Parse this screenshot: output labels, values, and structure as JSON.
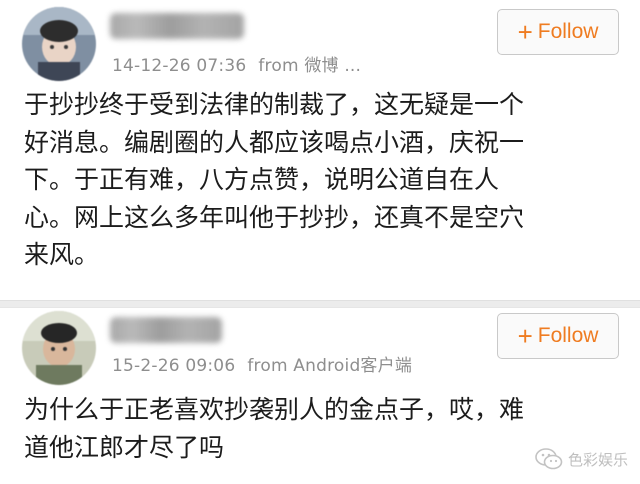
{
  "posts": [
    {
      "time": "14-12-26 07:36",
      "source": "from 微博 ...",
      "follow_label": "Follow",
      "follow_plus": "+",
      "text": "于抄抄终于受到法律的制裁了，这无疑是一个好消息。编剧圈的人都应该喝点小酒，庆祝一下。于正有难，八方点赞，说明公道自在人心。网上这么多年叫他于抄抄，还真不是空穴来风。",
      "lines": [
        "于抄抄终于受到法律的制裁了，这无疑是一个",
        "好消息。编剧圈的人都应该喝点小酒，庆祝一",
        "下。于正有难，八方点赞，说明公道自在人",
        "心。网上这么多年叫他于抄抄，还真不是空穴",
        "来风。"
      ]
    },
    {
      "time": "15-2-26 09:06",
      "source": "from Android客户端",
      "follow_label": "Follow",
      "follow_plus": "+",
      "text": "为什么于正老喜欢抄袭别人的金点子，哎，难道他江郎才尽了吗",
      "lines": [
        "为什么于正老喜欢抄袭别人的金点子，哎，难",
        "道他江郎才尽了吗"
      ]
    }
  ],
  "watermark": {
    "text": "色彩娱乐"
  },
  "colors": {
    "follow_text": "#ef7c21",
    "meta_text": "#8e8e8e",
    "divider": "#ececec"
  },
  "icons": {
    "follow": "plus-icon",
    "watermark": "wechat-icon"
  }
}
